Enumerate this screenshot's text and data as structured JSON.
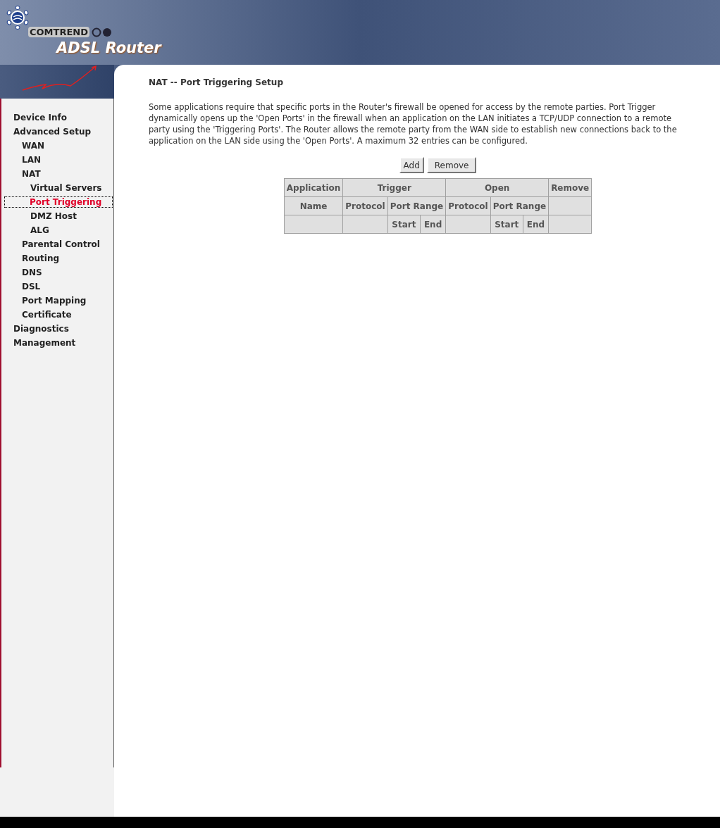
{
  "banner": {
    "brand": "COMTREND",
    "product": "ADSL Router"
  },
  "sidebar": {
    "items": [
      {
        "label": "Device Info",
        "selected": false
      },
      {
        "label": "Advanced Setup",
        "selected": false,
        "children": [
          {
            "label": "WAN",
            "selected": false
          },
          {
            "label": "LAN",
            "selected": false
          },
          {
            "label": "NAT",
            "selected": false,
            "children": [
              {
                "label": "Virtual Servers",
                "selected": false
              },
              {
                "label": "Port Triggering",
                "selected": true
              },
              {
                "label": "DMZ Host",
                "selected": false
              },
              {
                "label": "ALG",
                "selected": false
              }
            ]
          },
          {
            "label": "Parental Control",
            "selected": false
          },
          {
            "label": "Routing",
            "selected": false
          },
          {
            "label": "DNS",
            "selected": false
          },
          {
            "label": "DSL",
            "selected": false
          },
          {
            "label": "Port Mapping",
            "selected": false
          },
          {
            "label": "Certificate",
            "selected": false
          }
        ]
      },
      {
        "label": "Diagnostics",
        "selected": false
      },
      {
        "label": "Management",
        "selected": false
      }
    ]
  },
  "page": {
    "title": "NAT -- Port Triggering Setup",
    "description": "Some applications require that specific ports in the Router's firewall be opened for access by the remote parties. Port Trigger dynamically opens up the 'Open Ports' in the firewall when an application on the LAN initiates a TCP/UDP connection to a remote party using the 'Triggering Ports'. The Router allows the remote party from the WAN side to establish new connections back to the application on the LAN side using the 'Open Ports'. A maximum 32 entries can be configured.",
    "buttons": [
      "Add",
      "Remove"
    ],
    "table": {
      "group_row": [
        "Application",
        "Trigger",
        "Open",
        "Remove"
      ],
      "column_row": [
        "Name",
        "Protocol",
        "Port Range",
        "Protocol",
        "Port Range"
      ],
      "range_row": [
        "Start",
        "End",
        "Start",
        "End"
      ]
    }
  }
}
